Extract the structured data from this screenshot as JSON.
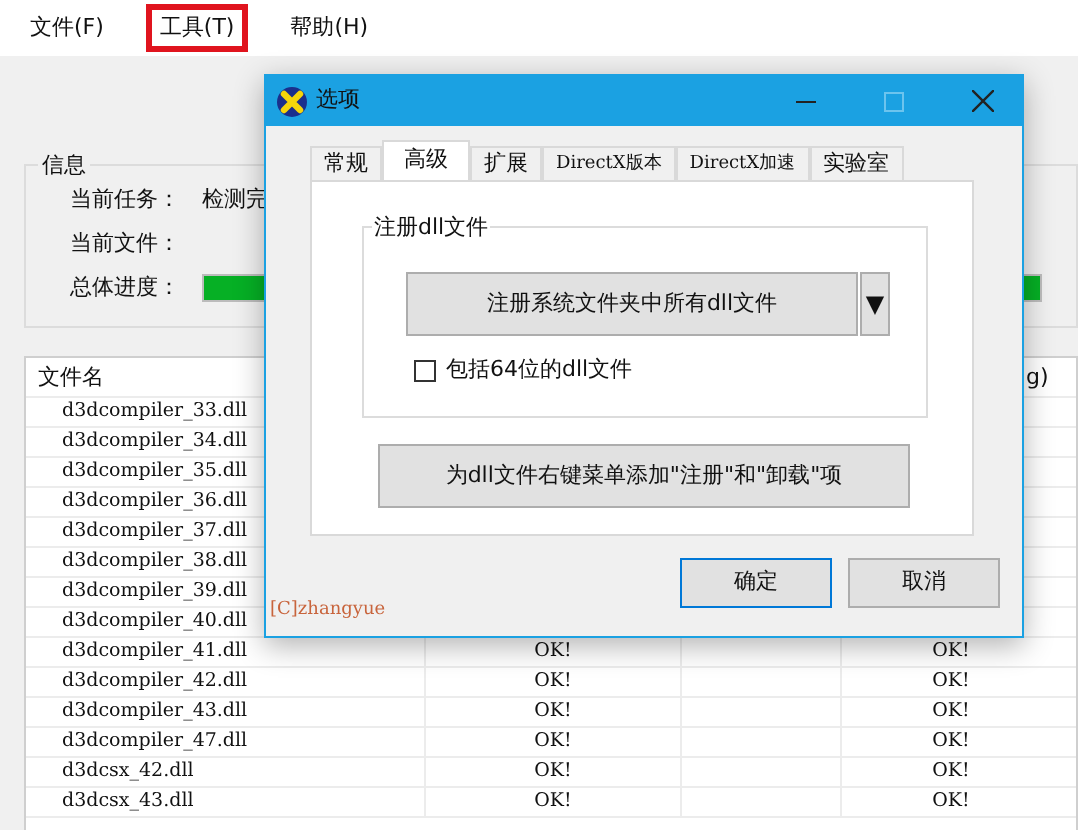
{
  "menu": [
    {
      "label": "文件(F)",
      "highlighted": false
    },
    {
      "label": "工具(T)",
      "highlighted": true
    },
    {
      "label": "帮助(H)",
      "highlighted": false
    }
  ],
  "info": {
    "title": "信息",
    "fields": [
      {
        "kind": "text",
        "label": "当前任务：",
        "value": "检测完"
      },
      {
        "kind": "text",
        "label": "当前文件："
      },
      {
        "kind": "progress",
        "label": "总体进度：",
        "level": 1
      }
    ]
  },
  "table": {
    "column_1": "文件名",
    "column_4": "g)",
    "rows": [
      {
        "column_1": "d3dcompiler_33.dll"
      },
      {
        "column_1": "d3dcompiler_34.dll"
      },
      {
        "column_1": "d3dcompiler_35.dll"
      },
      {
        "column_1": "d3dcompiler_36.dll"
      },
      {
        "column_1": "d3dcompiler_37.dll"
      },
      {
        "column_1": "d3dcompiler_38.dll"
      },
      {
        "column_1": "d3dcompiler_39.dll"
      },
      {
        "column_1": "d3dcompiler_40.dll"
      },
      {
        "column_1": "d3dcompiler_41.dll",
        "column_2": "OK!",
        "column_4": "OK!"
      },
      {
        "column_1": "d3dcompiler_42.dll",
        "column_2": "OK!",
        "column_4": "OK!"
      },
      {
        "column_1": "d3dcompiler_43.dll",
        "column_2": "OK!",
        "column_4": "OK!"
      },
      {
        "column_1": "d3dcompiler_47.dll",
        "column_2": "OK!",
        "column_4": "OK!"
      },
      {
        "column_1": "d3dcsx_42.dll",
        "column_2": "OK!",
        "column_4": "OK!"
      },
      {
        "column_1": "d3dcsx_43.dll",
        "column_2": "OK!",
        "column_4": "OK!"
      }
    ]
  },
  "dialog": {
    "title": "选项",
    "maximize_disabled": true,
    "tabs": [
      {
        "label": "常规",
        "selected": false
      },
      {
        "label": "高级",
        "selected": true
      },
      {
        "label": "扩展",
        "selected": false
      },
      {
        "label": "DirectX版本",
        "selected": false
      },
      {
        "label": "DirectX加速",
        "selected": false
      },
      {
        "label": "实验室",
        "selected": false
      }
    ],
    "group": {
      "title": "注册dll文件",
      "button": "注册系统文件夹中所有dll文件",
      "dropdown": "▼",
      "checkbox": {
        "label": "包括64位的dll文件",
        "checked": false
      }
    },
    "context_menu_button": "为dll文件右键菜单添加\"注册\"和\"卸载\"项",
    "buttons": [
      {
        "label": "确定",
        "default": true
      },
      {
        "label": "取消",
        "default": false
      }
    ],
    "credit": "[C]zhangyue"
  }
}
